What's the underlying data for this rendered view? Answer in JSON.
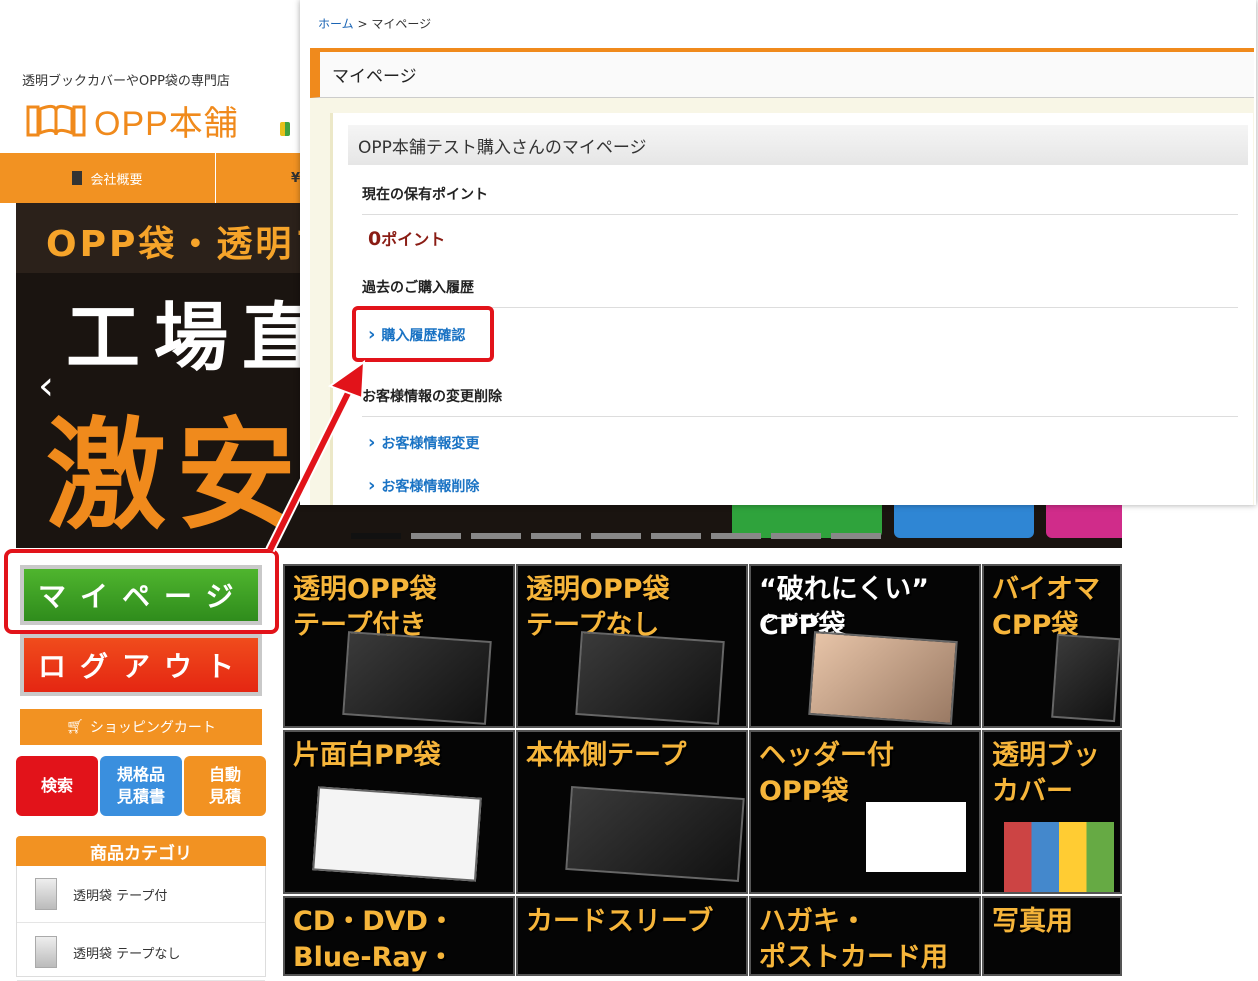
{
  "site": {
    "tagline": "透明ブックカバーやOPP袋の専門店",
    "logo_text": "OPP本舗",
    "nav": [
      {
        "label": "会社概要",
        "icon": "building-icon"
      },
      {
        "label": "",
        "icon": "yen-icon"
      }
    ]
  },
  "hero": {
    "line1": "OPP袋・透明ブ",
    "line2": "工場直売",
    "line3": "激安",
    "prev": "‹"
  },
  "left_menu": {
    "mypage": "マイページ",
    "logout": "ログアウト",
    "cart": "ショッピングカート",
    "search": "検索",
    "quote_std": "規格品\n見積書",
    "quote_auto": "自動\n見積",
    "category_title": "商品カテゴリ",
    "categories": [
      "透明袋 テープ付",
      "透明袋 テープなし"
    ]
  },
  "tiles": [
    {
      "title": "透明OPP袋\nテープ付き",
      "sub": ""
    },
    {
      "title": "透明OPP袋\nテープなし",
      "sub": ""
    },
    {
      "title": "“破れにくい”\nCPP袋",
      "sub": "シーピーピー"
    },
    {
      "title": "バイオマ\nCPP袋",
      "sub": ""
    },
    {
      "title": "片面白PP袋",
      "sub": ""
    },
    {
      "title": "本体側テープ",
      "sub": ""
    },
    {
      "title": "ヘッダー付\nOPP袋",
      "sub": ""
    },
    {
      "title": "透明ブッ\nカバー",
      "sub": ""
    },
    {
      "title": "CD・DVD・\nBlue-Ray・",
      "sub": ""
    },
    {
      "title": "カードスリーブ",
      "sub": ""
    },
    {
      "title": "ハガキ・\nポストカード用",
      "sub": ""
    },
    {
      "title": "写真用",
      "sub": ""
    }
  ],
  "panel": {
    "crumb_home": "ホーム",
    "crumb_sep": ">",
    "crumb_current": "マイページ",
    "title": "マイページ",
    "greeting": "OPP本舗テスト購入さんのマイページ",
    "points_heading": "現在の保有ポイント",
    "points_value": "0",
    "points_unit": "ポイント",
    "history_heading": "過去のご購入履歴",
    "history_link": "購入履歴確認",
    "customer_heading": "お客様情報の変更削除",
    "edit_link": "お客様情報変更",
    "delete_link": "お客様情報削除"
  },
  "colors": {
    "accent": "#f29222",
    "highlight": "#e2131a",
    "link": "#1a73c4",
    "points": "#8a1c14",
    "mypage_green": "#3a9e22"
  }
}
